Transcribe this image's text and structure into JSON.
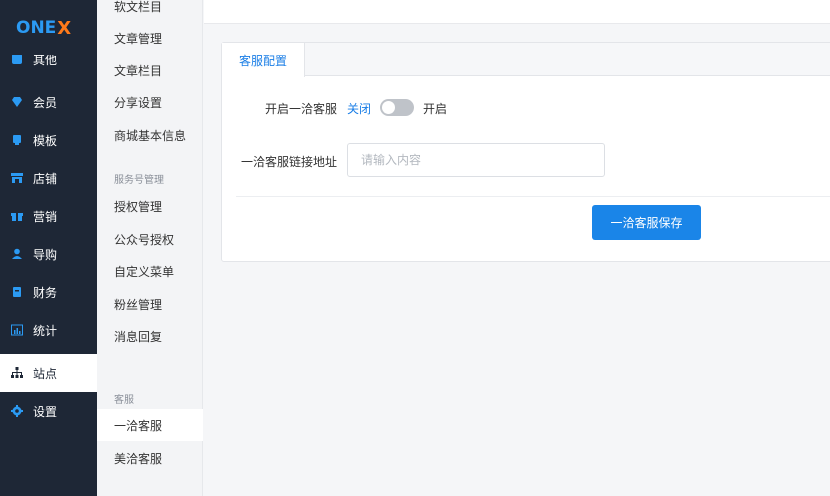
{
  "logo": {
    "text": "ONE",
    "mark": "X"
  },
  "nav": {
    "partial_label": "其他",
    "items": [
      {
        "label": "会员",
        "icon": "diamond-icon"
      },
      {
        "label": "模板",
        "icon": "template-icon"
      },
      {
        "label": "店铺",
        "icon": "store-icon"
      },
      {
        "label": "营销",
        "icon": "gift-icon"
      },
      {
        "label": "导购",
        "icon": "user-icon"
      },
      {
        "label": "财务",
        "icon": "wallet-icon"
      },
      {
        "label": "统计",
        "icon": "chart-icon"
      },
      {
        "label": "站点",
        "icon": "sitemap-icon"
      },
      {
        "label": "设置",
        "icon": "gear-icon"
      }
    ]
  },
  "sub_nav": {
    "group_top_items": [
      "软文栏目",
      "文章管理",
      "文章栏目",
      "分享设置",
      "商城基本信息"
    ],
    "service_heading": "服务号管理",
    "service_items": [
      "授权管理",
      "公众号授权",
      "自定义菜单",
      "粉丝管理",
      "消息回复"
    ],
    "kefu_heading": "客服",
    "kefu_items": [
      "一洽客服",
      "美洽客服"
    ]
  },
  "card": {
    "tab_label": "客服配置",
    "enable_label": "开启一洽客服",
    "off_text": "关闭",
    "on_text": "开启",
    "link_label": "一洽客服链接地址",
    "link_value": "",
    "link_placeholder": "请输入内容",
    "save_label": "一洽客服保存"
  },
  "colors": {
    "accent": "#1a85e8",
    "nav_bg": "#1e2736",
    "logo_x": "#ff7a1a"
  }
}
